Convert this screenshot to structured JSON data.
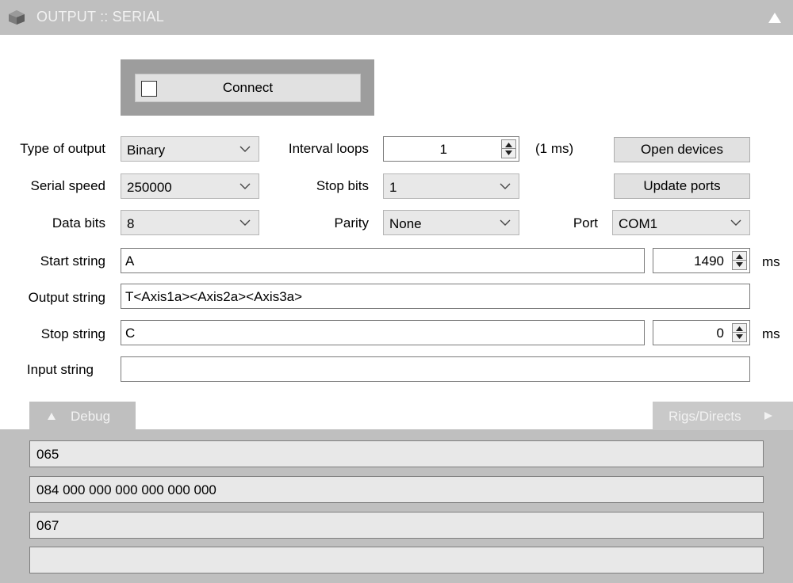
{
  "window": {
    "title": "OUTPUT :: SERIAL",
    "icon": "cube-icon",
    "collapse_icon": "triangle-up-icon"
  },
  "connect": {
    "label": "Connect",
    "checked": false
  },
  "type_of_output": {
    "label": "Type of output",
    "value": "Binary"
  },
  "serial_speed": {
    "label": "Serial speed",
    "value": "250000"
  },
  "data_bits": {
    "label": "Data bits",
    "value": "8"
  },
  "interval_loops": {
    "label": "Interval loops",
    "value": "1",
    "suffix": "(1 ms)"
  },
  "stop_bits": {
    "label": "Stop bits",
    "value": "1"
  },
  "parity": {
    "label": "Parity",
    "value": "None"
  },
  "port": {
    "label": "Port",
    "value": "COM1"
  },
  "buttons": {
    "open_devices": "Open devices",
    "update_ports": "Update ports"
  },
  "start_string": {
    "label": "Start string",
    "value": "A",
    "delay": "1490",
    "unit": "ms"
  },
  "output_string": {
    "label": "Output string",
    "value": "T<Axis1a><Axis2a><Axis3a>"
  },
  "stop_string": {
    "label": "Stop string",
    "value": "C",
    "delay": "0",
    "unit": "ms"
  },
  "input_string": {
    "label": "Input string",
    "value": ""
  },
  "tabs": {
    "debug": "Debug",
    "rigs": "Rigs/Directs"
  },
  "debug_output": [
    "065",
    "084 000 000 000 000 000 000",
    "067",
    ""
  ],
  "colors": {
    "title_bar": "#bfbfbf",
    "panel": "#ffffff",
    "combo_bg": "#e8e8e8",
    "button_bg": "#e1e1e1",
    "frame": "#9d9d9d"
  }
}
